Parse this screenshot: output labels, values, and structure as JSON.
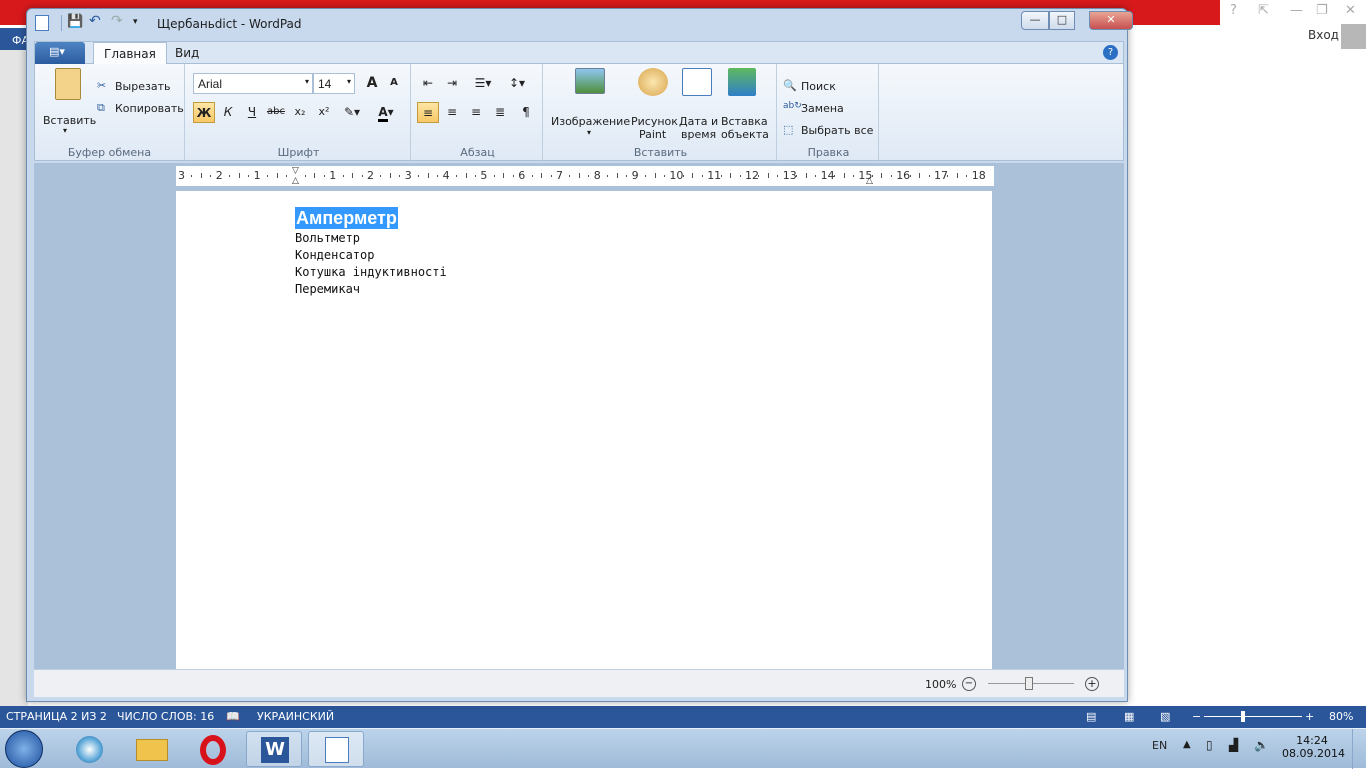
{
  "background_word": {
    "strip_label": "ФА",
    "signin_label": "Вход",
    "help_glyph": "?",
    "status": {
      "page": "СТРАНИЦА 2 ИЗ 2",
      "words": "ЧИСЛО СЛОВ: 16",
      "language": "УКРАИНСКИЙ",
      "zoom": "80%"
    }
  },
  "wordpad": {
    "title": "Щербаньdict - WordPad",
    "window_controls": {
      "minimize": "—",
      "maximize": "□",
      "close": "✕"
    },
    "tabs": [
      {
        "label": "Главная"
      },
      {
        "label": "Вид"
      }
    ],
    "clipboard": {
      "paste": "Вставить",
      "cut": "Вырезать",
      "copy": "Копировать",
      "group": "Буфер обмена"
    },
    "font": {
      "name": "Arial",
      "size": "14",
      "grow": "A",
      "shrink": "A",
      "bold": "Ж",
      "italic": "К",
      "underline": "Ч",
      "strike": "abc",
      "subscript": "x₂",
      "superscript": "x²",
      "group": "Шрифт"
    },
    "paragraph": {
      "group": "Абзац"
    },
    "insert": {
      "picture": "Изображение",
      "paint_line1": "Рисунок",
      "paint_line2": "Paint",
      "date_line1": "Дата и",
      "date_line2": "время",
      "object_line1": "Вставка",
      "object_line2": "объекта",
      "group": "Вставить"
    },
    "editing": {
      "find": "Поиск",
      "replace": "Замена",
      "select_all": "Выбрать все",
      "group": "Правка"
    },
    "ruler_labels": [
      "3",
      "2",
      "1",
      "",
      "1",
      "2",
      "3",
      "4",
      "5",
      "6",
      "7",
      "8",
      "9",
      "10",
      "11",
      "12",
      "13",
      "14",
      "15",
      "16",
      "17",
      "18"
    ],
    "document": {
      "lines": [
        "Амперметр",
        "Вольтметр",
        "Конденсатор",
        "Котушка індуктивності",
        "Перемикач"
      ]
    },
    "zoom": "100%",
    "zoom_fraction": 0.5
  },
  "taskbar": {
    "lang": "EN",
    "time": "14:24",
    "date": "08.09.2014"
  },
  "colors": {
    "accent": "#2b579a",
    "selection": "#3399ff",
    "word_red": "#d7191c"
  }
}
